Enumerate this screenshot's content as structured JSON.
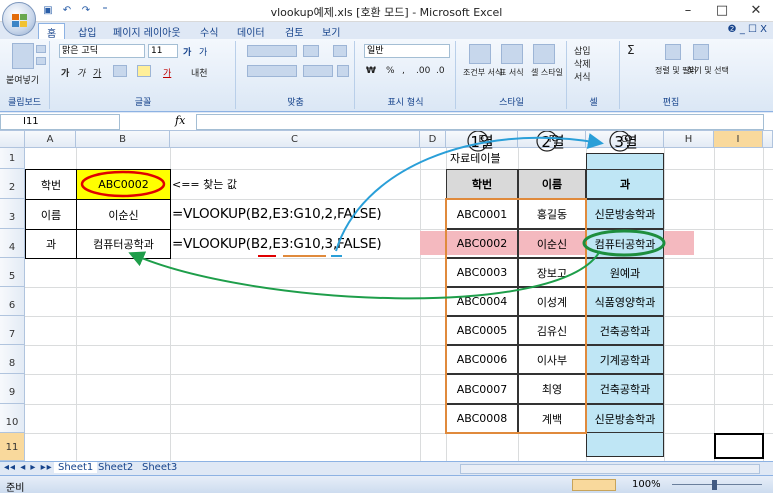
{
  "window": {
    "title": "vlookup예제.xls  [호환 모드] - Microsoft Excel",
    "controls": [
      "–",
      "□",
      "✕"
    ]
  },
  "qat": {
    "save": "▣",
    "undo": "↶",
    "redo": "↷",
    "more": "⁼"
  },
  "ribbon": {
    "tabs": [
      "홈",
      "삽입",
      "페이지 레이아웃",
      "수식",
      "데이터",
      "검토",
      "보기"
    ],
    "active_tab": "홈",
    "help": "❷ _ ☐ X",
    "clipboard": {
      "paste": "붙여넣기",
      "label": "클립보드"
    },
    "font": {
      "name": "맑은 고딕",
      "size": "11",
      "label": "글꼴",
      "bold": "가",
      "italic": "가",
      "underline": "가",
      "grow": "가",
      "shrink": "가",
      "hangul": "내천",
      "fontcolor": "가"
    },
    "alignment": {
      "label": "맞춤"
    },
    "number": {
      "format": "일반",
      "label": "표시 형식",
      "currency": "₩",
      "percent": "%",
      "comma": ",",
      "inc": ".00",
      "dec": ".0"
    },
    "styles": {
      "cond": "조건부\n서식",
      "table": "표\n서식",
      "cell": "셀\n스타일",
      "label": "스타일"
    },
    "cells": {
      "insert": "삽입",
      "delete": "삭제",
      "format": "서식",
      "label": "셀"
    },
    "editing": {
      "sum": "Σ",
      "sort": "정렬 및\n필터",
      "find": "찾기 및\n선택",
      "label": "편집"
    }
  },
  "formula_bar": {
    "name_box": "I11",
    "fx": "fx",
    "content": ""
  },
  "columns": [
    "A",
    "B",
    "C",
    "D",
    "E",
    "F",
    "G",
    "H",
    "I"
  ],
  "rows": [
    "1",
    "2",
    "3",
    "4",
    "5",
    "6",
    "7",
    "8",
    "9",
    "10",
    "11"
  ],
  "lookup": {
    "label_id": "학번",
    "label_name": "이름",
    "label_dept": "과",
    "key_value": "ABC0002",
    "arrow_note": "<== 찾는 값",
    "name_result": "이순신",
    "dept_result": "컴퓨터공학과",
    "formula_name": "=VLOOKUP(B2,E3:G10,2,FALSE)",
    "formula_dept": "=VLOOKUP(B2,E3:G10,3,FALSE)"
  },
  "annotations": {
    "col1": "1열",
    "col2": "2열",
    "col3": "3열",
    "table_caption": "자료테이블"
  },
  "table": {
    "headers": [
      "학번",
      "이름",
      "과"
    ],
    "rows": [
      [
        "ABC0001",
        "홍길동",
        "신문방송학과"
      ],
      [
        "ABC0002",
        "이순신",
        "컴퓨터공학과"
      ],
      [
        "ABC0003",
        "장보고",
        "원예과"
      ],
      [
        "ABC0004",
        "이성계",
        "식품영양학과"
      ],
      [
        "ABC0005",
        "김유신",
        "건축공학과"
      ],
      [
        "ABC0006",
        "이사부",
        "기계공학과"
      ],
      [
        "ABC0007",
        "최영",
        "건축공학과"
      ],
      [
        "ABC0008",
        "계백",
        "신문방송학과"
      ]
    ]
  },
  "sheets": [
    "Sheet1",
    "Sheet2",
    "Sheet3"
  ],
  "status": {
    "ready": "준비",
    "zoom": "100%"
  },
  "colors": {
    "key_fill": "#ffff00",
    "key_ring": "#e00000",
    "match_row": "#f4b9bf",
    "result_col": "#bfe6f5",
    "result_ring": "#1e8e3e",
    "table_border": "#e08a3c",
    "arrow_blue": "#2a9fd8",
    "arrow_green": "#1e9e4a"
  }
}
